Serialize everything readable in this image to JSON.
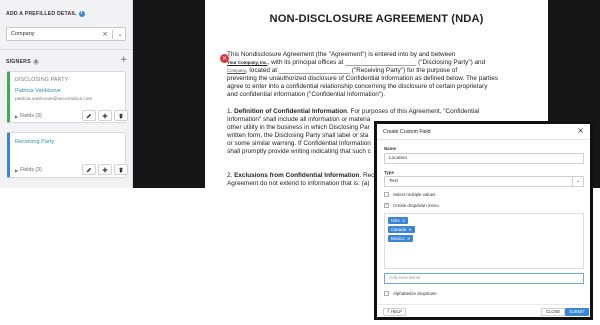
{
  "sidebar": {
    "prefill_title": "ADD A PREFILLED DETAIL",
    "info_icon": "i",
    "prefill_select": {
      "value": "Company",
      "clear_icon": "×",
      "chevron_icon": "⌄"
    },
    "signers_title": "SIGNERS",
    "signers_count": "2",
    "add_icon": "+",
    "signers": [
      {
        "caption": "DISCLOSING PARTY",
        "name": "Patricia VanHoove",
        "email": "patricia.vanhoove@securedocs.com",
        "fields": "Fields (3)",
        "color": "#3daa58"
      },
      {
        "caption": "",
        "name": "Receiving Party",
        "email": "",
        "fields": "Fields (3)",
        "color": "#3a86d4"
      }
    ]
  },
  "document": {
    "title": "NON-DISCLOSURE AGREEMENT (NDA)",
    "error_icon": "×",
    "p1_l1": "This Nondisclosure Agreement (the \"Agreement\") is entered into by and between",
    "p1_company": "Your Company, Inc.",
    "p1_l2_rest": ", with its principal offices at ____________________ (\"Disclosing Party\") and",
    "p1_company_small": "Company",
    "p1_l3_rest": ", located at ____________________ (\"Receiving Party\") for the purpose of",
    "p1_l4": "preventing the unauthorized disclosure of Confidential Information as defined below. The parties",
    "p1_l5": "agree to enter into a confidential relationship concerning the disclosure of certain proprietary",
    "p1_l6": "and confidential information (\"Confidential Information\").",
    "p2_l1_num": "1. ",
    "p2_l1_bold": "Definition of Confidential Information",
    "p2_l1_rest": ". For purposes of this Agreement, \"Confidential",
    "p2_l2": "Information\" shall include all information or materia",
    "p2_l3": "other utility in the business in which Disclosing Par",
    "p2_l4": "written form, the Disclosing Party shall label or sta",
    "p2_l5": "or some similar warning. If Confidential Information",
    "p2_l6": "shall promptly provide writing indicating that such c",
    "p3_l1_num": "2. ",
    "p3_l1_bold": "Exclusions from Confidential Information",
    "p3_l1_rest": ". Rec",
    "p3_l2": "Agreement do not extend to information that is: (a)"
  },
  "modal": {
    "title": "Create Custom Field",
    "close_icon": "×",
    "name_label": "Name",
    "name_value": "Location",
    "type_label": "Type",
    "type_value": "Text",
    "type_chevron": "⌄",
    "multi_label": "Select multiple values",
    "dropdown_label": "Create dropdown menu",
    "check_icon": "✓",
    "tags": [
      "USA",
      "Canada",
      "Mexico"
    ],
    "tag_remove_icon": "✕",
    "add_item_placeholder": "Add new items",
    "alpha_label": "Alphabetize dropdown",
    "help_icon": "?",
    "help_label": "HELP",
    "cancel_label": "CLOSE",
    "submit_label": "SUBMIT"
  }
}
